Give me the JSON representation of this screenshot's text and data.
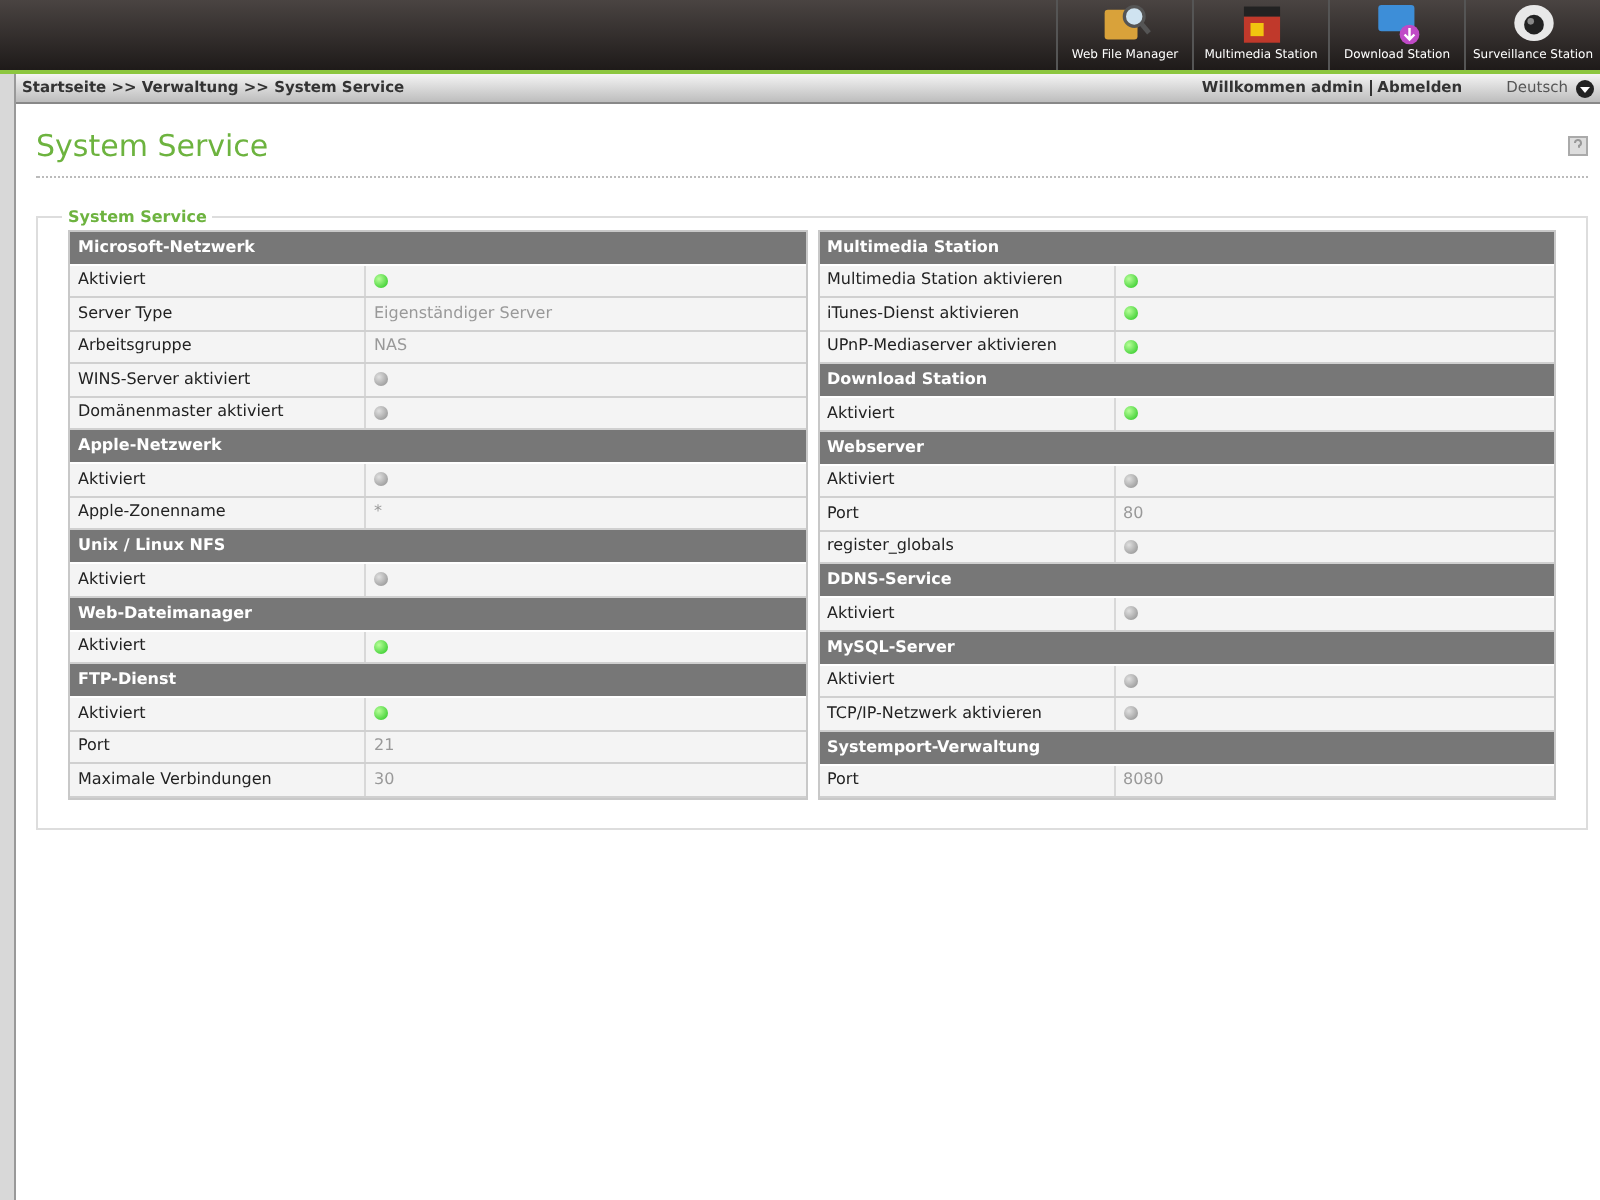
{
  "apps": [
    {
      "label": "Web File Manager"
    },
    {
      "label": "Multimedia Station"
    },
    {
      "label": "Download Station"
    },
    {
      "label": "Surveillance Station"
    }
  ],
  "breadcrumb": "Startseite >> Verwaltung >> System Service",
  "welcome": "Willkommen admin",
  "logout": "Abmelden",
  "language": "Deutsch",
  "page_title": "System Service",
  "group_title": "System Service",
  "columns": [
    [
      {
        "title": "Microsoft-Netzwerk",
        "rows": [
          {
            "label": "Aktiviert",
            "kind": "status",
            "on": true
          },
          {
            "label": "Server Type",
            "kind": "value",
            "value": "Eigenständiger Server"
          },
          {
            "label": "Arbeitsgruppe",
            "kind": "value",
            "value": "NAS"
          },
          {
            "label": "WINS-Server aktiviert",
            "kind": "status",
            "on": false
          },
          {
            "label": "Domänenmaster aktiviert",
            "kind": "status",
            "on": false
          }
        ]
      },
      {
        "title": "Apple-Netzwerk",
        "rows": [
          {
            "label": "Aktiviert",
            "kind": "status",
            "on": false
          },
          {
            "label": "Apple-Zonenname",
            "kind": "value",
            "value": "*"
          }
        ]
      },
      {
        "title": "Unix / Linux NFS",
        "rows": [
          {
            "label": "Aktiviert",
            "kind": "status",
            "on": false
          }
        ]
      },
      {
        "title": "Web-Dateimanager",
        "rows": [
          {
            "label": "Aktiviert",
            "kind": "status",
            "on": true
          }
        ]
      },
      {
        "title": "FTP-Dienst",
        "rows": [
          {
            "label": "Aktiviert",
            "kind": "status",
            "on": true
          },
          {
            "label": "Port",
            "kind": "value",
            "value": "21"
          },
          {
            "label": "Maximale Verbindungen",
            "kind": "value",
            "value": "30"
          }
        ]
      }
    ],
    [
      {
        "title": "Multimedia Station",
        "rows": [
          {
            "label": "Multimedia Station aktivieren",
            "kind": "status",
            "on": true
          },
          {
            "label": "iTunes-Dienst aktivieren",
            "kind": "status",
            "on": true
          },
          {
            "label": "UPnP-Mediaserver aktivieren",
            "kind": "status",
            "on": true
          }
        ]
      },
      {
        "title": "Download Station",
        "rows": [
          {
            "label": "Aktiviert",
            "kind": "status",
            "on": true
          }
        ]
      },
      {
        "title": "Webserver",
        "rows": [
          {
            "label": "Aktiviert",
            "kind": "status",
            "on": false
          },
          {
            "label": "Port",
            "kind": "value",
            "value": "80"
          },
          {
            "label": "register_globals",
            "kind": "status",
            "on": false
          }
        ]
      },
      {
        "title": "DDNS-Service",
        "rows": [
          {
            "label": "Aktiviert",
            "kind": "status",
            "on": false
          }
        ]
      },
      {
        "title": "MySQL-Server",
        "rows": [
          {
            "label": "Aktiviert",
            "kind": "status",
            "on": false
          },
          {
            "label": "TCP/IP-Netzwerk aktivieren",
            "kind": "status",
            "on": false
          }
        ]
      },
      {
        "title": "Systemport-Verwaltung",
        "rows": [
          {
            "label": "Port",
            "kind": "value",
            "value": "8080"
          }
        ]
      }
    ]
  ]
}
